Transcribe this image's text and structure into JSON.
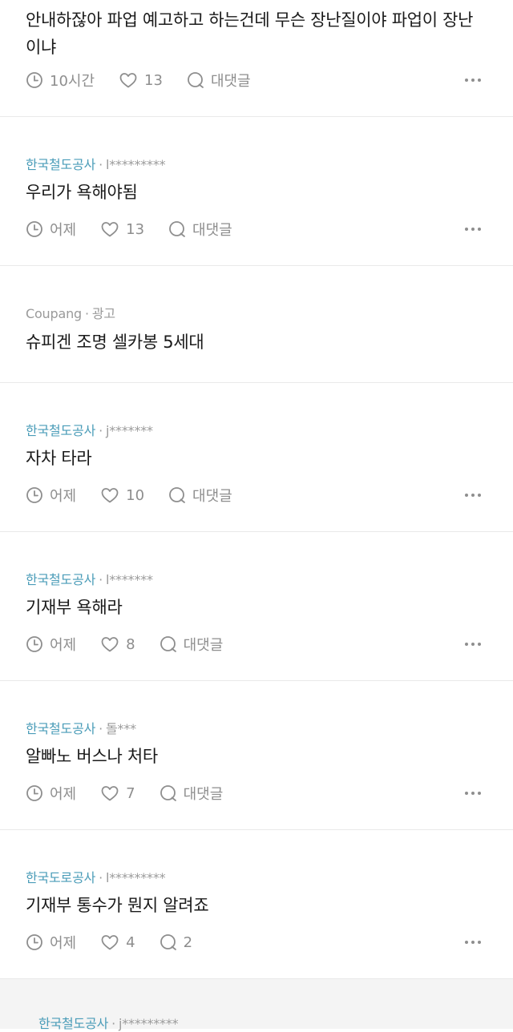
{
  "posts": [
    {
      "content_line1": "안내하잖아 파업 예고하고 하는건데 무슨 장난질이야 파업이 장난",
      "content_line2": "이냐",
      "time": "10시간",
      "likes": "13",
      "comments": "대댓글"
    },
    {
      "company": "한국철도공사",
      "author": "l*********",
      "content": "우리가 욕해야됨",
      "time": "어제",
      "likes": "13",
      "comments": "대댓글"
    },
    {
      "company": "한국철도공사",
      "author": "j*******",
      "content": "자차 타라",
      "time": "어제",
      "likes": "10",
      "comments": "대댓글"
    },
    {
      "company": "한국철도공사",
      "author": "l*******",
      "content": "기재부 욕해라",
      "time": "어제",
      "likes": "8",
      "comments": "대댓글"
    },
    {
      "company": "한국철도공사",
      "author": "돌***",
      "content": "알빠노 버스나 처타",
      "time": "어제",
      "likes": "7",
      "comments": "대댓글"
    },
    {
      "company": "한국도로공사",
      "author": "l*********",
      "content": "기재부 통수가 뭔지 알려죠",
      "time": "어제",
      "likes": "4",
      "comments": "2"
    },
    {
      "company": "한국철도공사",
      "author": "j*********"
    }
  ],
  "ad": {
    "sponsor": "Coupang",
    "label": "광고",
    "content": "슈피겐 조명 셀카봉 5세대"
  },
  "separator": "·",
  "colors": {
    "company": "#4a9cb8",
    "meta_gray": "#9a9a9a",
    "divider": "#e9e9e9"
  },
  "icons": {
    "time": "clock-icon",
    "likes": "heart-icon",
    "comments": "speech-bubble-icon",
    "more": "more-dots-icon"
  }
}
